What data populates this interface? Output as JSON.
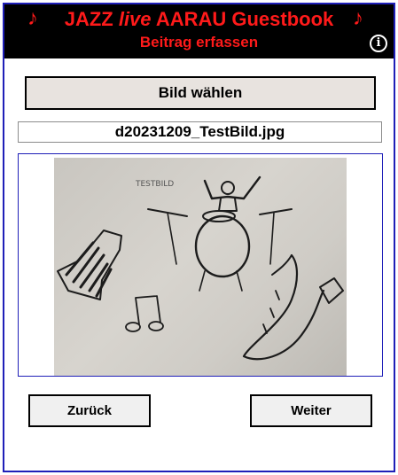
{
  "header": {
    "title_part1": "JAZZ ",
    "title_live": "live",
    "title_part2": " AARAU Guestbook",
    "subtitle": "Beitrag erfassen",
    "note_icon": "music-note-icon",
    "info_icon": "info-icon",
    "background_color": "#000000",
    "text_color": "#ff1a1a"
  },
  "form": {
    "choose_image_label": "Bild wählen",
    "filename": "d20231209_TestBild.jpg",
    "preview_sketch_text": "TESTBILD"
  },
  "nav": {
    "back_label": "Zurück",
    "next_label": "Weiter"
  },
  "colors": {
    "frame_border": "#1f1fb8"
  }
}
